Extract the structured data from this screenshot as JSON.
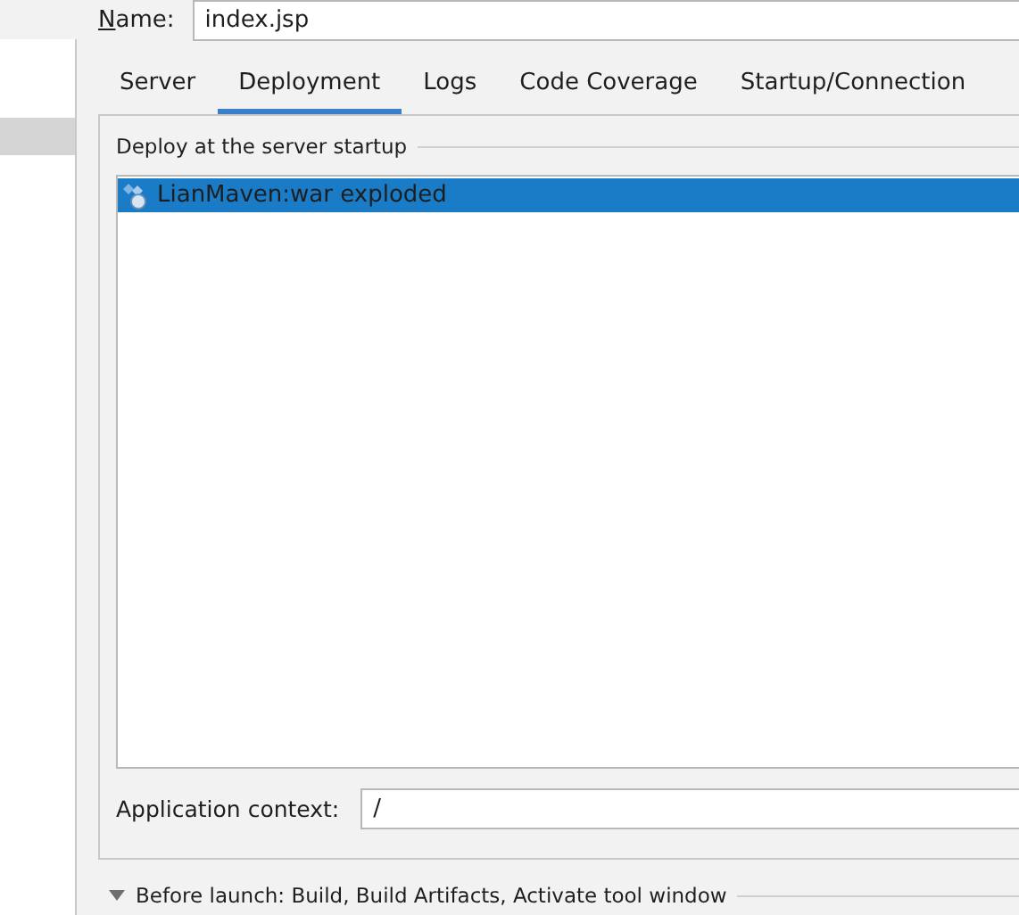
{
  "name_field": {
    "label": "Name:",
    "value": "index.jsp"
  },
  "tabs": [
    {
      "label": "Server",
      "selected": false
    },
    {
      "label": "Deployment",
      "selected": true
    },
    {
      "label": "Logs",
      "selected": false
    },
    {
      "label": "Code Coverage",
      "selected": false
    },
    {
      "label": "Startup/Connection",
      "selected": false
    }
  ],
  "deploy": {
    "title": "Deploy at the server startup",
    "items": [
      {
        "label": "LianMaven:war exploded",
        "selected": true
      }
    ]
  },
  "application_context": {
    "label": "Application context:",
    "value": "/"
  },
  "before_launch": {
    "label": "Before launch: Build, Build Artifacts, Activate tool window",
    "expanded": true
  }
}
